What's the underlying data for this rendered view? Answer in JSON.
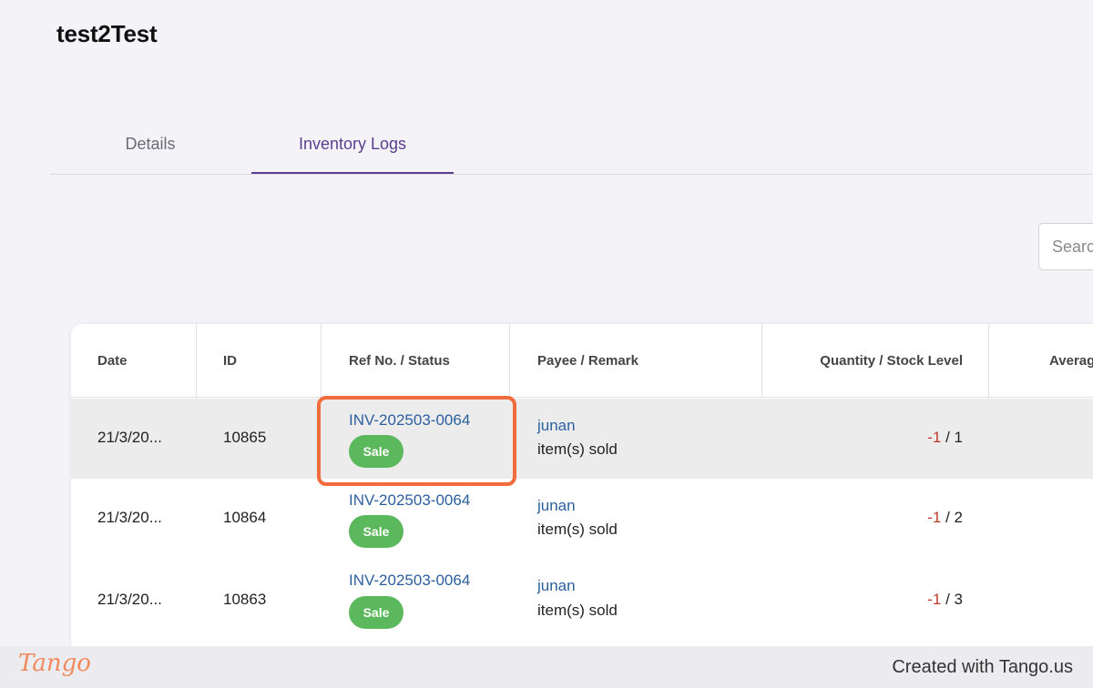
{
  "page": {
    "title": "test2Test"
  },
  "tabs": [
    {
      "label": "Details",
      "active": false
    },
    {
      "label": "Inventory Logs",
      "active": true
    }
  ],
  "search": {
    "placeholder": "Search"
  },
  "table": {
    "columns": [
      "Date",
      "ID",
      "Ref No. / Status",
      "Payee / Remark",
      "Quantity / Stock Level",
      "Averag"
    ],
    "rows": [
      {
        "date": "21/3/20...",
        "id": "10865",
        "ref": "INV-202503-0064",
        "status": "Sale",
        "payee": "junan",
        "remark": "item(s) sold",
        "qty": "-1",
        "stock": " / 1",
        "highlighted": true
      },
      {
        "date": "21/3/20...",
        "id": "10864",
        "ref": "INV-202503-0064",
        "status": "Sale",
        "payee": "junan",
        "remark": "item(s) sold",
        "qty": "-1",
        "stock": " / 2",
        "highlighted": false
      },
      {
        "date": "21/3/20...",
        "id": "10863",
        "ref": "INV-202503-0064",
        "status": "Sale",
        "payee": "junan",
        "remark": "item(s) sold",
        "qty": "-1",
        "stock": " / 3",
        "highlighted": false
      }
    ]
  },
  "footer": {
    "brand": "Tango",
    "credit": "Created with Tango.us"
  },
  "colors": {
    "accent": "#5b3e8f",
    "sale_badge": "#5cb85c",
    "highlight": "#f26b3a",
    "link": "#2c5fa0",
    "negative": "#c0392b"
  }
}
